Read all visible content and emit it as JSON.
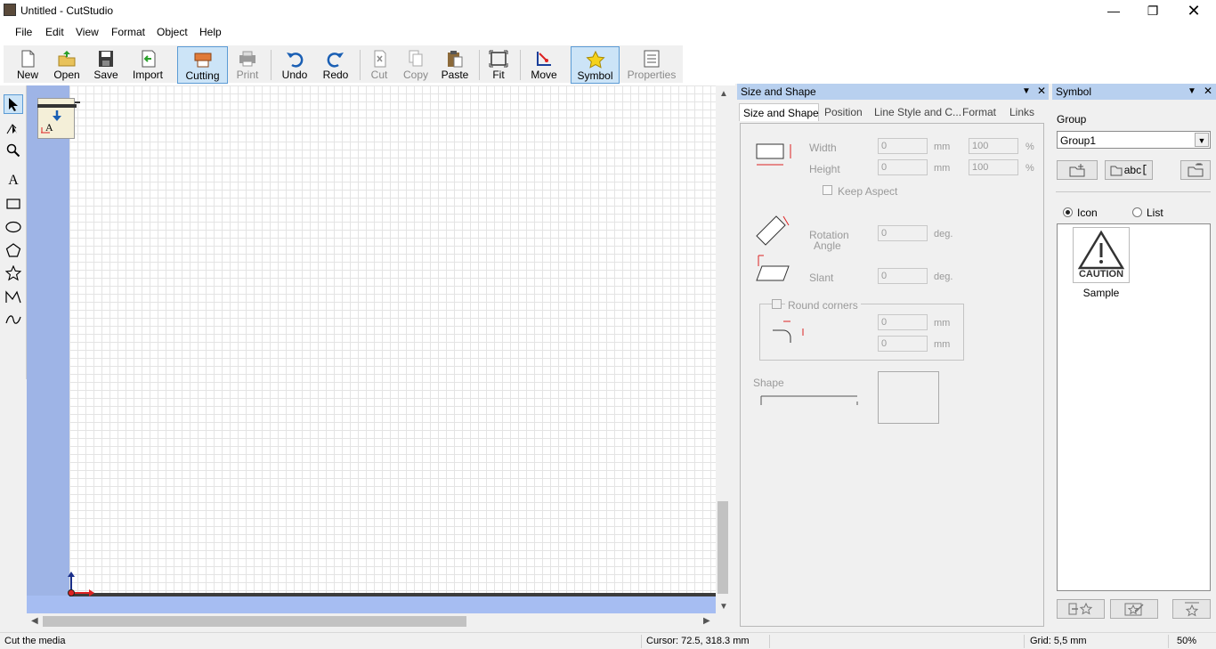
{
  "window": {
    "title": "Untitled - CutStudio"
  },
  "menu": [
    "File",
    "Edit",
    "View",
    "Format",
    "Object",
    "Help"
  ],
  "toolbar": {
    "new": "New",
    "open": "Open",
    "save": "Save",
    "import": "Import",
    "cutting": "Cutting",
    "print": "Print",
    "undo": "Undo",
    "redo": "Redo",
    "cut": "Cut",
    "copy": "Copy",
    "paste": "Paste",
    "fit": "Fit",
    "move": "Move",
    "symbol": "Symbol",
    "properties": "Properties"
  },
  "size_panel": {
    "title": "Size and Shape",
    "tabs": [
      "Size and Shape",
      "Position",
      "Line Style and C...",
      "Format",
      "Links"
    ],
    "width_label": "Width",
    "height_label": "Height",
    "width_value": "0",
    "height_value": "0",
    "width_pct": "100",
    "height_pct": "100",
    "unit_mm": "mm",
    "unit_pct": "%",
    "unit_deg": "deg.",
    "keep_aspect": "Keep Aspect",
    "rotation_label_1": "Rotation",
    "rotation_label_2": "Angle",
    "rotation_value": "0",
    "slant_label": "Slant",
    "slant_value": "0",
    "round_corners": "Round corners",
    "round_x": "0",
    "round_y": "0",
    "shape_label": "Shape"
  },
  "symbol_panel": {
    "title": "Symbol",
    "group_label": "Group",
    "group_value": "Group1",
    "rename_label": "abc",
    "view_icon": "Icon",
    "view_list": "List",
    "item_caption": "CAUTION",
    "item_label": "Sample"
  },
  "statusbar": {
    "message": "Cut the media",
    "cursor": "Cursor: 72.5, 318.3 mm",
    "grid": "Grid: 5,5 mm",
    "zoom": "50%"
  },
  "colors": {
    "accent": "#5b9bd5",
    "ruler": "#9eb4e6",
    "panel_header": "#b8d0ef"
  }
}
